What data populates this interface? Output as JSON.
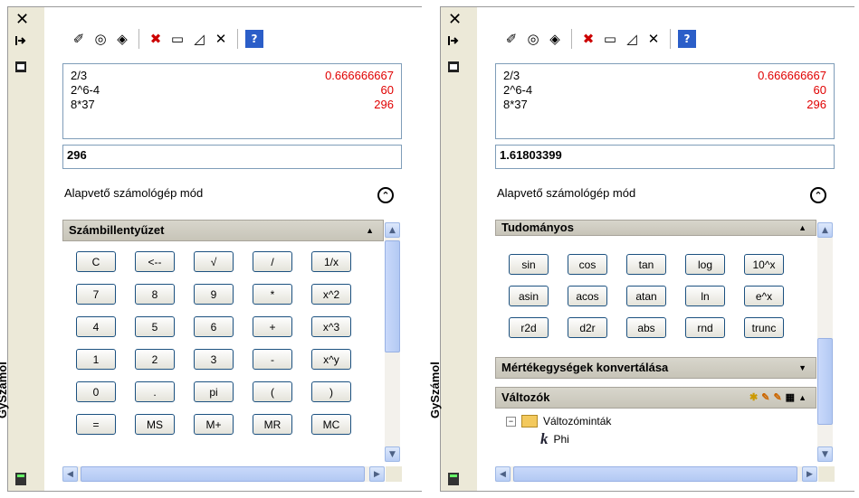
{
  "left": {
    "palette_title": "GySzámol",
    "history": [
      {
        "expr": "2/3",
        "result": "0.666666667"
      },
      {
        "expr": "2^6-4",
        "result": "60"
      },
      {
        "expr": "8*37",
        "result": "296"
      }
    ],
    "input_value": "296",
    "mode_label": "Alapvető számológép mód",
    "section_title": "Számbillentyűzet",
    "keys": [
      "C",
      "<--",
      "√",
      "/",
      "1/x",
      "7",
      "8",
      "9",
      "*",
      "x^2",
      "4",
      "5",
      "6",
      "+",
      "x^3",
      "1",
      "2",
      "3",
      "-",
      "x^y",
      "0",
      ".",
      "pi",
      "(",
      ")",
      "=",
      "MS",
      "M+",
      "MR",
      "MC"
    ]
  },
  "right": {
    "palette_title": "GySzámol",
    "history": [
      {
        "expr": "2/3",
        "result": "0.666666667"
      },
      {
        "expr": "2^6-4",
        "result": "60"
      },
      {
        "expr": "8*37",
        "result": "296"
      }
    ],
    "input_value": "1.61803399",
    "mode_label": "Alapvető számológép mód",
    "sci_title": "Tudományos",
    "sci_keys": [
      "sin",
      "cos",
      "tan",
      "log",
      "10^x",
      "asin",
      "acos",
      "atan",
      "ln",
      "e^x",
      "r2d",
      "d2r",
      "abs",
      "rnd",
      "trunc"
    ],
    "units_title": "Mértékegységek konvertálása",
    "vars_title": "Változók",
    "vars_folder": "Változóminták",
    "vars_item": "Phi"
  },
  "icons": [
    "close-icon",
    "autohide-icon",
    "properties-icon",
    "eraser-icon",
    "point-icon",
    "angle-icon",
    "select-object-icon",
    "distance-icon",
    "triangle-icon",
    "intersection-icon",
    "help-icon",
    "calculator-icon"
  ],
  "colors": {
    "result": "#e00000",
    "header": "#c7c4b8",
    "button_border": "#1c5180"
  }
}
